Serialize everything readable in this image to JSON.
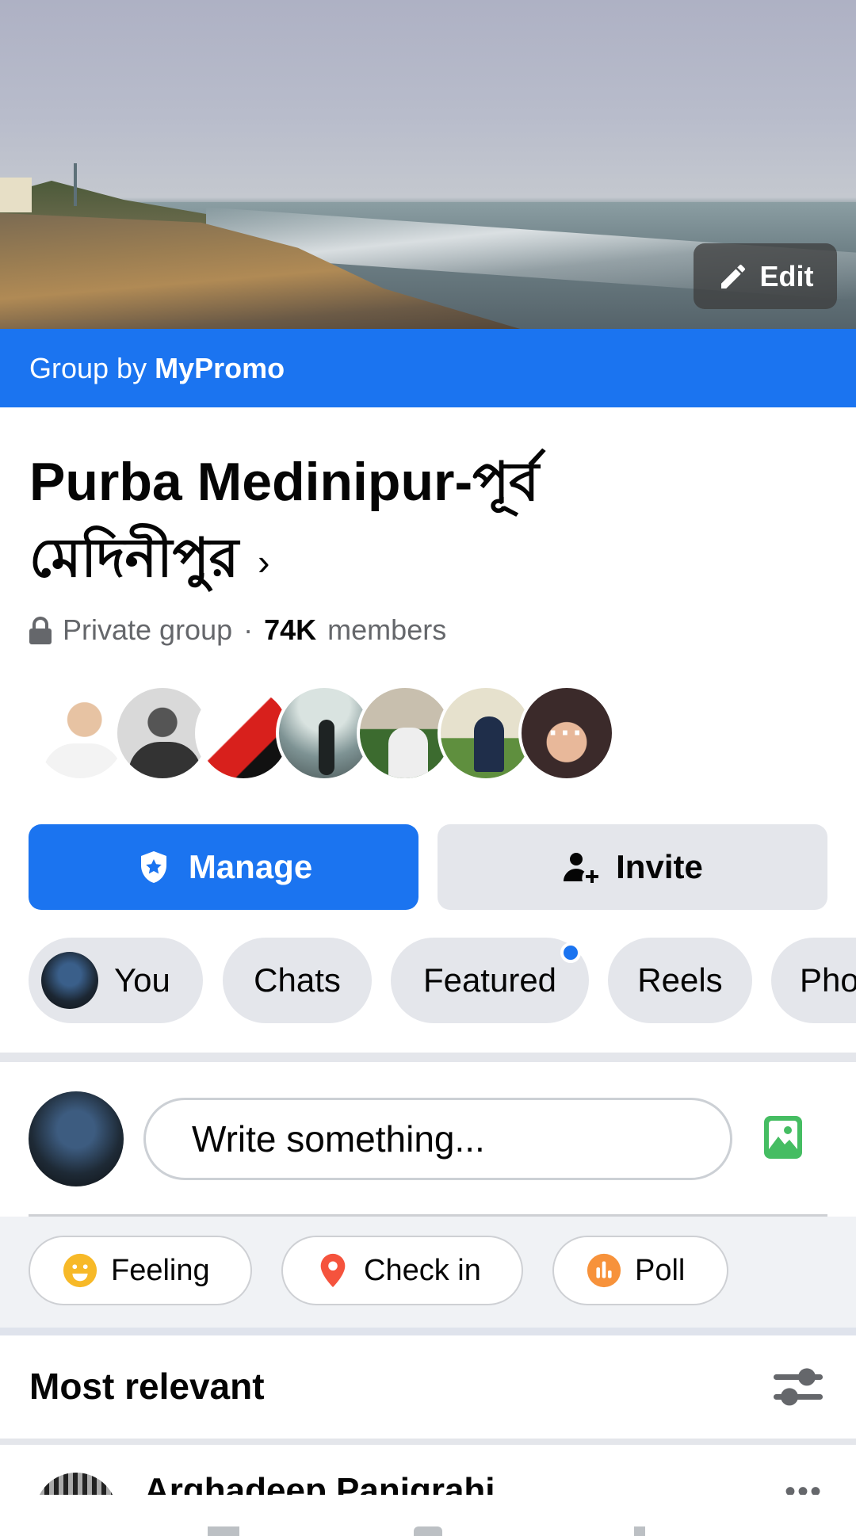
{
  "cover": {
    "edit_label": "Edit"
  },
  "group_by": {
    "prefix": "Group by",
    "brand": "MyPromo"
  },
  "group": {
    "title": "Purba Medinipur-পূর্ব মেদিনীপুর",
    "privacy": "Private group",
    "separator": "·",
    "member_count": "74K",
    "member_label": "members"
  },
  "avatar_overflow": "···",
  "actions": {
    "manage": "Manage",
    "invite": "Invite"
  },
  "tabs": [
    {
      "label": "You"
    },
    {
      "label": "Chats"
    },
    {
      "label": "Featured",
      "has_notification": true
    },
    {
      "label": "Reels"
    },
    {
      "label": "Photos"
    }
  ],
  "composer": {
    "placeholder": "Write something..."
  },
  "quick_actions": [
    {
      "label": "Feeling",
      "icon": "feeling-icon"
    },
    {
      "label": "Check in",
      "icon": "location-pin-icon"
    },
    {
      "label": "Poll",
      "icon": "poll-icon"
    }
  ],
  "feed": {
    "sort_label": "Most relevant",
    "first_post_author": "Arghadeep Panigrahi"
  },
  "colors": {
    "brand_blue": "#1b74f0",
    "chip_gray": "#e4e6eb",
    "secondary_text": "#65676b"
  }
}
